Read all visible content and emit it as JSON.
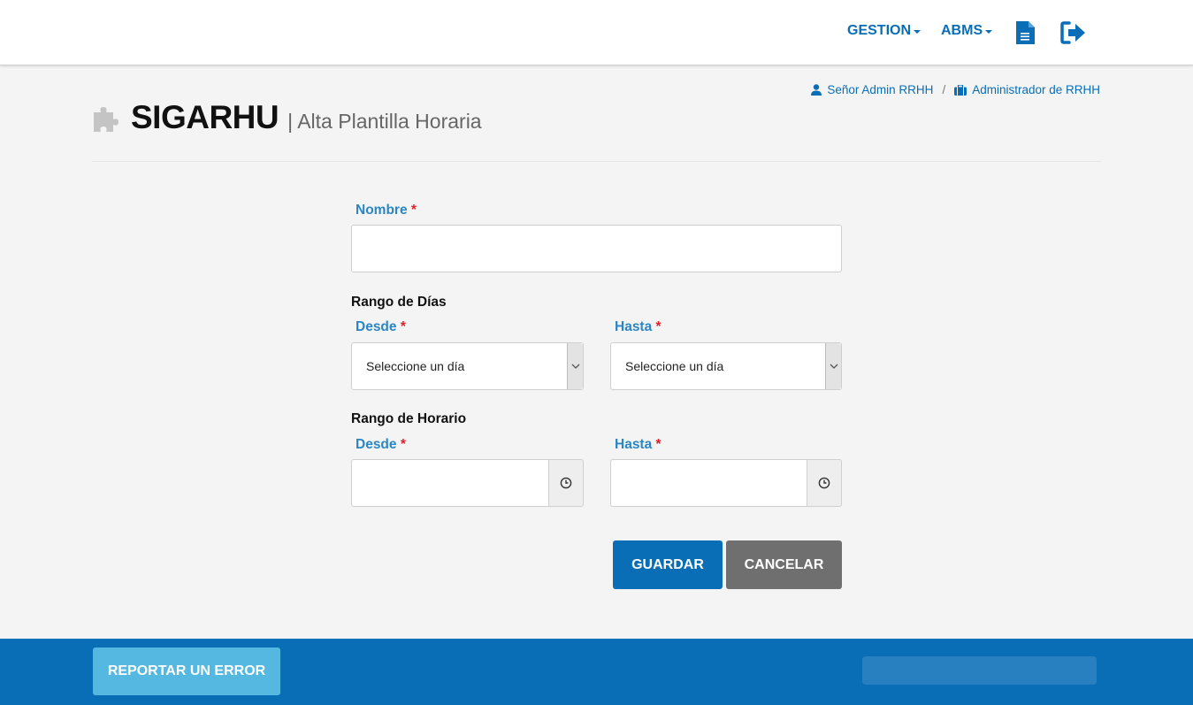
{
  "nav": {
    "gestion_label": "GESTION",
    "abms_label": "ABMS",
    "icons": [
      "document-icon",
      "logout-icon"
    ],
    "accent_color": "#0a6eb7"
  },
  "breadcrumb": {
    "user": "Señor Admin RRHH",
    "separator": "/",
    "role": "Administrador de RRHH"
  },
  "header": {
    "title": "SIGARHU",
    "subtitle": "| Alta Plantilla Horaria"
  },
  "form": {
    "nombre_label": "Nombre",
    "required_mark": "*",
    "nombre_value": "",
    "rango_dias_label": "Rango de Días",
    "dias_desde_label": "Desde",
    "dias_hasta_label": "Hasta",
    "dias_desde_value": "Seleccione un día",
    "dias_hasta_value": "Seleccione un día",
    "rango_horario_label": "Rango de Horario",
    "hora_desde_label": "Desde",
    "hora_hasta_label": "Hasta",
    "hora_desde_value": "",
    "hora_hasta_value": ""
  },
  "actions": {
    "save_label": "GUARDAR",
    "cancel_label": "CANCELAR"
  },
  "footer": {
    "report_label": "REPORTAR UN ERROR"
  }
}
